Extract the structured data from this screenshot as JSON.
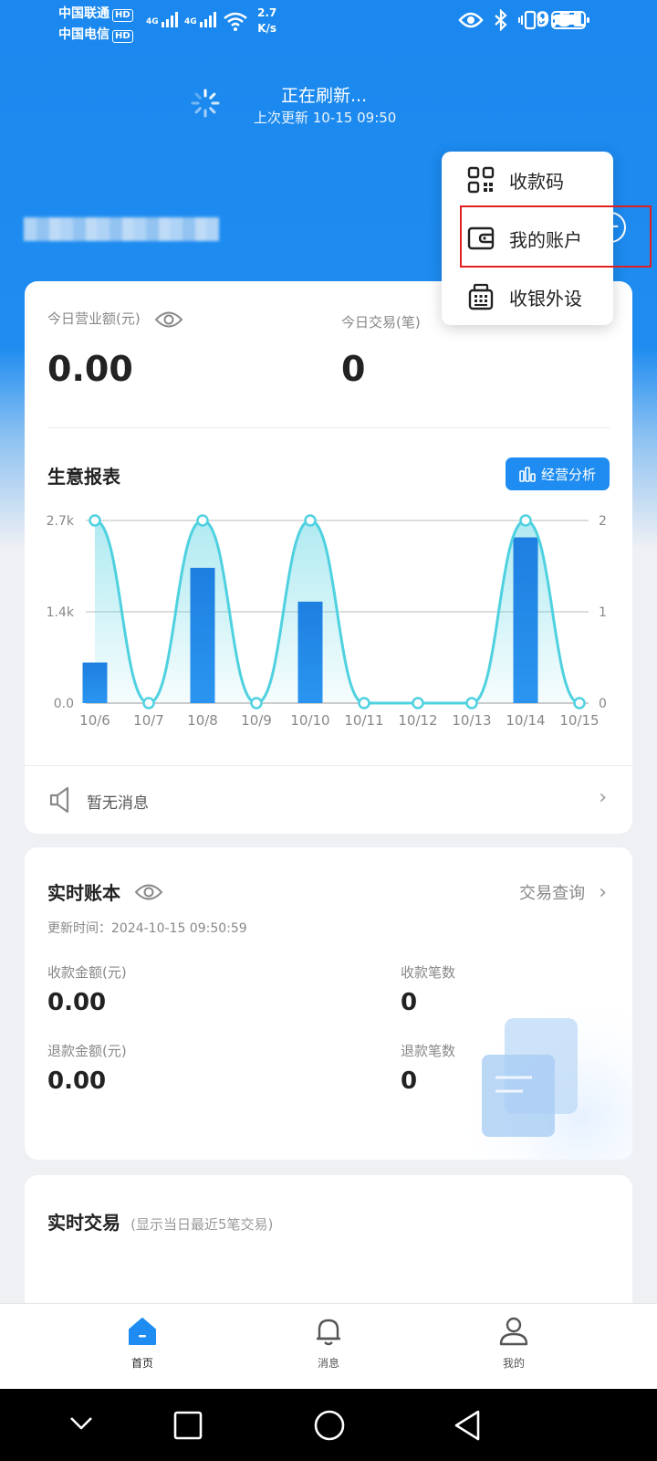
{
  "status_bar": {
    "carrier1": "中国联通",
    "carrier2": "中国电信",
    "hd": "HD",
    "signal_label": "4G",
    "net_speed_value": "2.7",
    "net_speed_unit": "K/s",
    "time": "9:51"
  },
  "refresh": {
    "title": "正在刷新...",
    "subtitle": "上次更新 10-15 09:50"
  },
  "dropdown": {
    "items": [
      {
        "label": "收款码",
        "icon": "qr-code-icon"
      },
      {
        "label": "我的账户",
        "icon": "wallet-icon"
      },
      {
        "label": "收银外设",
        "icon": "cash-register-icon"
      }
    ]
  },
  "summary": {
    "revenue_label": "今日营业额(元)",
    "revenue_value": "0.00",
    "transactions_label": "今日交易(笔)",
    "transactions_value": "0"
  },
  "report": {
    "title": "生意报表",
    "analysis_button": "经营分析"
  },
  "chart_data": {
    "type": "bar",
    "categories": [
      "10/6",
      "10/7",
      "10/8",
      "10/9",
      "10/10",
      "10/11",
      "10/12",
      "10/13",
      "10/14",
      "10/15"
    ],
    "series": [
      {
        "type": "bar",
        "axis": "left",
        "color": "#1e88e5",
        "values": [
          600,
          0,
          2000,
          0,
          1500,
          0,
          0,
          0,
          2450,
          0
        ]
      },
      {
        "type": "line",
        "axis": "right",
        "color": "#4fd1e0",
        "values": [
          2,
          0,
          2,
          0,
          2,
          0,
          0,
          0,
          2,
          0
        ]
      }
    ],
    "left_axis": {
      "ticks": [
        "0.0",
        "1.4k",
        "2.7k"
      ],
      "range": [
        0,
        2700
      ]
    },
    "right_axis": {
      "ticks": [
        "0",
        "1",
        "2"
      ],
      "range": [
        0,
        2
      ]
    },
    "grid": true
  },
  "notice": {
    "text": "暂无消息"
  },
  "ledger": {
    "title": "实时账本",
    "query_link": "交易查询",
    "update_time": "更新时间：2024-10-15 09:50:59",
    "receipt_amount_label": "收款金额(元)",
    "receipt_amount": "0.00",
    "receipt_count_label": "收款笔数",
    "receipt_count": "0",
    "refund_amount_label": "退款金额(元)",
    "refund_amount": "0.00",
    "refund_count_label": "退款笔数",
    "refund_count": "0"
  },
  "realtime": {
    "title": "实时交易",
    "subtitle": "(显示当日最近5笔交易)"
  },
  "bottom_nav": {
    "items": [
      {
        "label": "首页",
        "icon": "home-icon",
        "active": true
      },
      {
        "label": "消息",
        "icon": "bell-icon",
        "active": false
      },
      {
        "label": "我的",
        "icon": "user-icon",
        "active": false
      }
    ]
  },
  "colors": {
    "brand_blue": "#1e8cf0",
    "highlight_red": "#e02020"
  }
}
